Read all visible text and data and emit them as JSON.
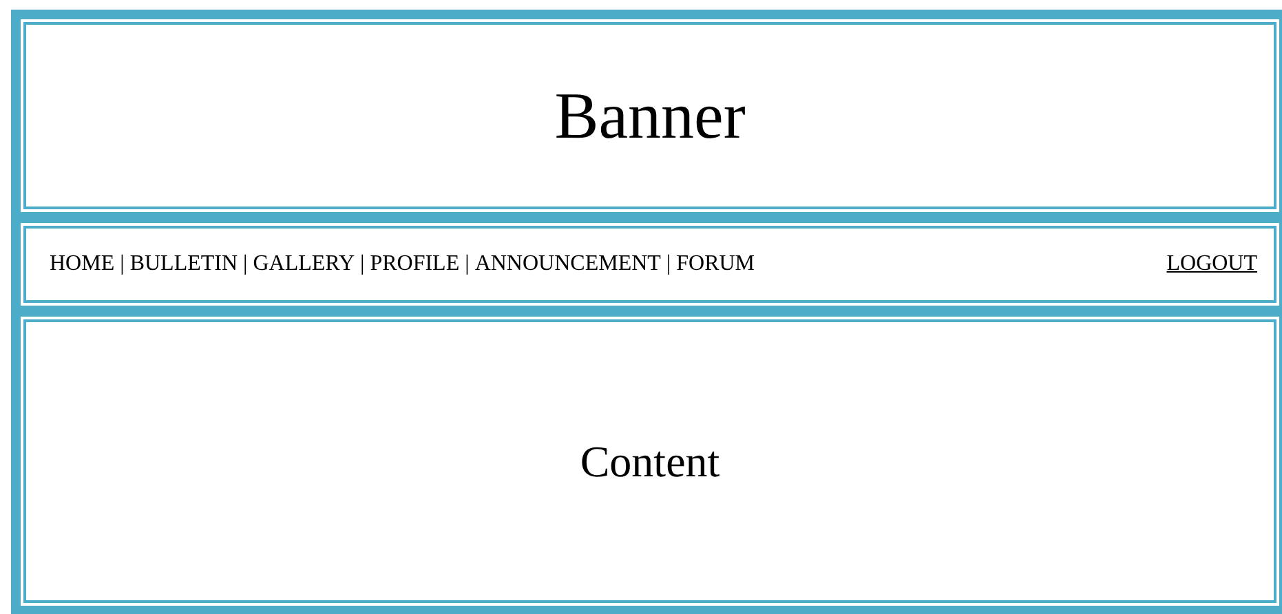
{
  "banner": {
    "title": "Banner"
  },
  "nav": {
    "items": [
      {
        "text": "HOME",
        "separator": "|"
      },
      {
        "text": "BULLETIN",
        "separator": "|"
      },
      {
        "text": "GALLERY",
        "separator": "|"
      },
      {
        "text": "PROFILE",
        "separator": "|"
      },
      {
        "text": "ANNOUNCEMENT",
        "separator": "|"
      },
      {
        "text": "FORUM"
      }
    ],
    "logout": {
      "text": "LOGOUT"
    }
  },
  "content": {
    "text": "Content"
  }
}
